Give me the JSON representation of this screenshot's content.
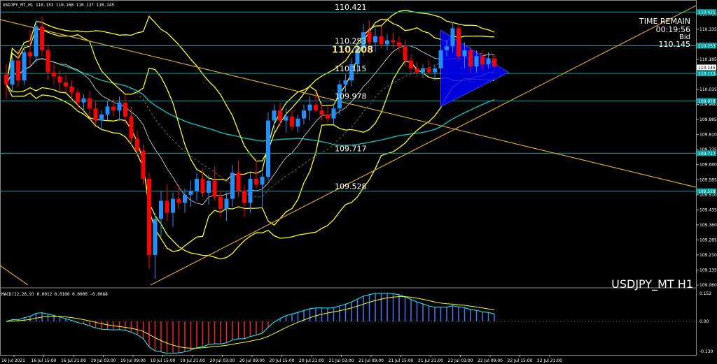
{
  "header": {
    "info": "USDJPY_MT,H1  110.133 110.168 110.127 110.145"
  },
  "symbol_label": "USDJPY_MT H1",
  "time_remain": {
    "label": "TIME REMAIN",
    "value": "00:19:56"
  },
  "bid": {
    "label": "Bid",
    "value": "110.145"
  },
  "macd_label": "MACD(12,26,9) 0.0012 0.0100 0.0000 -0.0088",
  "colors": {
    "background": "#000000",
    "bull": "#1e90ff",
    "bear": "#ff0000",
    "band": "#ffff00",
    "trend": "#daa520",
    "ma_cyan": "#00bfbf",
    "level": "#00a0a0",
    "triangle": "#0000ff"
  },
  "chart_data": {
    "type": "candlestick",
    "title": "USDJPY_MT H1",
    "ylim": [
      109.06,
      110.46
    ],
    "price_ticks": [
      "110.410",
      "110.335",
      "110.260",
      "110.185",
      "110.110",
      "110.035",
      "109.960",
      "109.885",
      "109.810",
      "109.735",
      "109.660",
      "109.585",
      "109.510",
      "109.435",
      "109.360",
      "109.285",
      "109.210",
      "109.135",
      "109.060"
    ],
    "time_ticks": [
      "16 Jul 2021",
      "16 Jul 15:00",
      "16 Jul 21:00",
      "19 Jul 03:00",
      "19 Jul 09:00",
      "19 Jul 15:00",
      "19 Jul 21:00",
      "20 Jul 03:00",
      "20 Jul 09:00",
      "20 Jul 15:00",
      "20 Jul 21:00",
      "21 Jul 03:00",
      "21 Jul 09:00",
      "21 Jul 15:00",
      "21 Jul 21:00",
      "22 Jul 03:00",
      "22 Jul 09:00",
      "22 Jul 15:00",
      "22 Jul 21:00"
    ],
    "levels": [
      {
        "value": 110.421,
        "label": "110.421"
      },
      {
        "value": 110.253,
        "label": "110.253"
      },
      {
        "value": 110.208,
        "label": "110.208"
      },
      {
        "value": 110.115,
        "label": "110.115"
      },
      {
        "value": 109.978,
        "label": "109.978"
      },
      {
        "value": 109.717,
        "label": "109.717"
      },
      {
        "value": 109.528,
        "label": "109.528"
      }
    ],
    "axis_markers": [
      {
        "value": 110.421,
        "label": "110.421",
        "color": "#00a0a0"
      },
      {
        "value": 110.253,
        "label": "110.253",
        "color": "#00a0a0"
      },
      {
        "value": 110.145,
        "label": "110.145",
        "color": "#ffffff"
      },
      {
        "value": 110.115,
        "label": "110.115",
        "color": "#00a0a0"
      },
      {
        "value": 109.978,
        "label": "109.978",
        "color": "#00a0a0"
      },
      {
        "value": 109.717,
        "label": "109.717",
        "color": "#00a0a0"
      },
      {
        "value": 109.528,
        "label": "109.528",
        "color": "#00a0a0"
      }
    ],
    "macd_ticks": [
      "0.152",
      "0.00",
      "-0.130"
    ],
    "ohlc": [
      [
        110.11,
        110.16,
        109.99,
        110.06
      ],
      [
        110.06,
        110.2,
        110.02,
        110.18
      ],
      [
        110.18,
        110.23,
        110.05,
        110.08
      ],
      [
        110.08,
        110.25,
        110.06,
        110.22
      ],
      [
        110.22,
        110.33,
        110.15,
        110.2
      ],
      [
        110.2,
        110.38,
        110.17,
        110.35
      ],
      [
        110.35,
        110.4,
        110.2,
        110.23
      ],
      [
        110.23,
        110.26,
        110.08,
        110.12
      ],
      [
        110.12,
        110.16,
        110.06,
        110.1
      ],
      [
        110.1,
        110.13,
        110.03,
        110.07
      ],
      [
        110.07,
        110.11,
        110.02,
        110.05
      ],
      [
        110.05,
        110.08,
        109.99,
        110.02
      ],
      [
        110.02,
        110.04,
        109.94,
        109.97
      ],
      [
        109.97,
        110.01,
        109.92,
        109.99
      ],
      [
        109.99,
        110.03,
        109.9,
        109.94
      ],
      [
        109.94,
        109.98,
        109.86,
        109.88
      ],
      [
        109.88,
        109.93,
        109.83,
        109.91
      ],
      [
        109.91,
        109.98,
        109.88,
        109.95
      ],
      [
        109.95,
        109.99,
        109.9,
        109.93
      ],
      [
        109.93,
        110.0,
        109.88,
        109.97
      ],
      [
        109.97,
        110.01,
        109.86,
        109.9
      ],
      [
        109.9,
        109.95,
        109.76,
        109.79
      ],
      [
        109.79,
        109.83,
        109.7,
        109.73
      ],
      [
        109.73,
        109.76,
        109.56,
        109.59
      ],
      [
        109.59,
        109.62,
        109.14,
        109.21
      ],
      [
        109.21,
        109.42,
        109.09,
        109.39
      ],
      [
        109.39,
        109.53,
        109.3,
        109.48
      ],
      [
        109.48,
        109.56,
        109.38,
        109.42
      ],
      [
        109.42,
        109.52,
        109.35,
        109.49
      ],
      [
        109.49,
        109.56,
        109.44,
        109.47
      ],
      [
        109.47,
        109.54,
        109.42,
        109.51
      ],
      [
        109.51,
        109.58,
        109.45,
        109.53
      ],
      [
        109.53,
        109.62,
        109.48,
        109.59
      ],
      [
        109.59,
        109.64,
        109.5,
        109.52
      ],
      [
        109.52,
        109.61,
        109.46,
        109.58
      ],
      [
        109.58,
        109.65,
        109.48,
        109.5
      ],
      [
        109.5,
        109.53,
        109.4,
        109.44
      ],
      [
        109.44,
        109.52,
        109.38,
        109.49
      ],
      [
        109.49,
        109.66,
        109.45,
        109.62
      ],
      [
        109.62,
        109.68,
        109.5,
        109.53
      ],
      [
        109.53,
        109.56,
        109.4,
        109.47
      ],
      [
        109.47,
        109.62,
        109.42,
        109.59
      ],
      [
        109.59,
        109.68,
        109.54,
        109.56
      ],
      [
        109.56,
        109.62,
        109.45,
        109.6
      ],
      [
        109.6,
        109.92,
        109.58,
        109.88
      ],
      [
        109.88,
        109.96,
        109.82,
        109.93
      ],
      [
        109.93,
        109.97,
        109.85,
        109.88
      ],
      [
        109.88,
        109.94,
        109.82,
        109.9
      ],
      [
        109.9,
        109.93,
        109.83,
        109.85
      ],
      [
        109.85,
        109.91,
        109.82,
        109.89
      ],
      [
        109.89,
        109.96,
        109.86,
        109.93
      ],
      [
        109.93,
        110.0,
        109.88,
        109.96
      ],
      [
        109.96,
        110.02,
        109.92,
        109.93
      ],
      [
        109.93,
        109.97,
        109.88,
        109.91
      ],
      [
        109.91,
        109.95,
        109.87,
        109.89
      ],
      [
        109.89,
        109.96,
        109.86,
        109.94
      ],
      [
        109.94,
        110.08,
        109.91,
        110.06
      ],
      [
        110.06,
        110.11,
        110.02,
        110.08
      ],
      [
        110.08,
        110.19,
        110.05,
        110.16
      ],
      [
        110.16,
        110.26,
        110.12,
        110.24
      ],
      [
        110.24,
        110.36,
        110.2,
        110.32
      ],
      [
        110.32,
        110.38,
        110.25,
        110.27
      ],
      [
        110.27,
        110.34,
        110.22,
        110.3
      ],
      [
        110.3,
        110.35,
        110.24,
        110.26
      ],
      [
        110.26,
        110.31,
        110.23,
        110.28
      ],
      [
        110.28,
        110.32,
        110.24,
        110.27
      ],
      [
        110.27,
        110.3,
        110.22,
        110.25
      ],
      [
        110.25,
        110.28,
        110.15,
        110.18
      ],
      [
        110.18,
        110.21,
        110.11,
        110.14
      ],
      [
        110.14,
        110.17,
        110.1,
        110.12
      ],
      [
        110.12,
        110.16,
        110.09,
        110.14
      ],
      [
        110.14,
        110.18,
        110.11,
        110.12
      ],
      [
        110.12,
        110.16,
        110.08,
        110.14
      ],
      [
        110.14,
        110.26,
        110.11,
        110.23
      ],
      [
        110.23,
        110.28,
        110.2,
        110.25
      ],
      [
        110.25,
        110.37,
        110.22,
        110.34
      ],
      [
        110.34,
        110.36,
        110.18,
        110.2
      ],
      [
        110.2,
        110.27,
        110.14,
        110.23
      ],
      [
        110.23,
        110.25,
        110.12,
        110.15
      ],
      [
        110.15,
        110.23,
        110.12,
        110.2
      ],
      [
        110.2,
        110.23,
        110.13,
        110.16
      ],
      [
        110.16,
        110.22,
        110.14,
        110.19
      ],
      [
        110.19,
        110.21,
        110.14,
        110.15
      ]
    ],
    "macd": {
      "ylim": [
        -0.13,
        0.152
      ]
    }
  }
}
